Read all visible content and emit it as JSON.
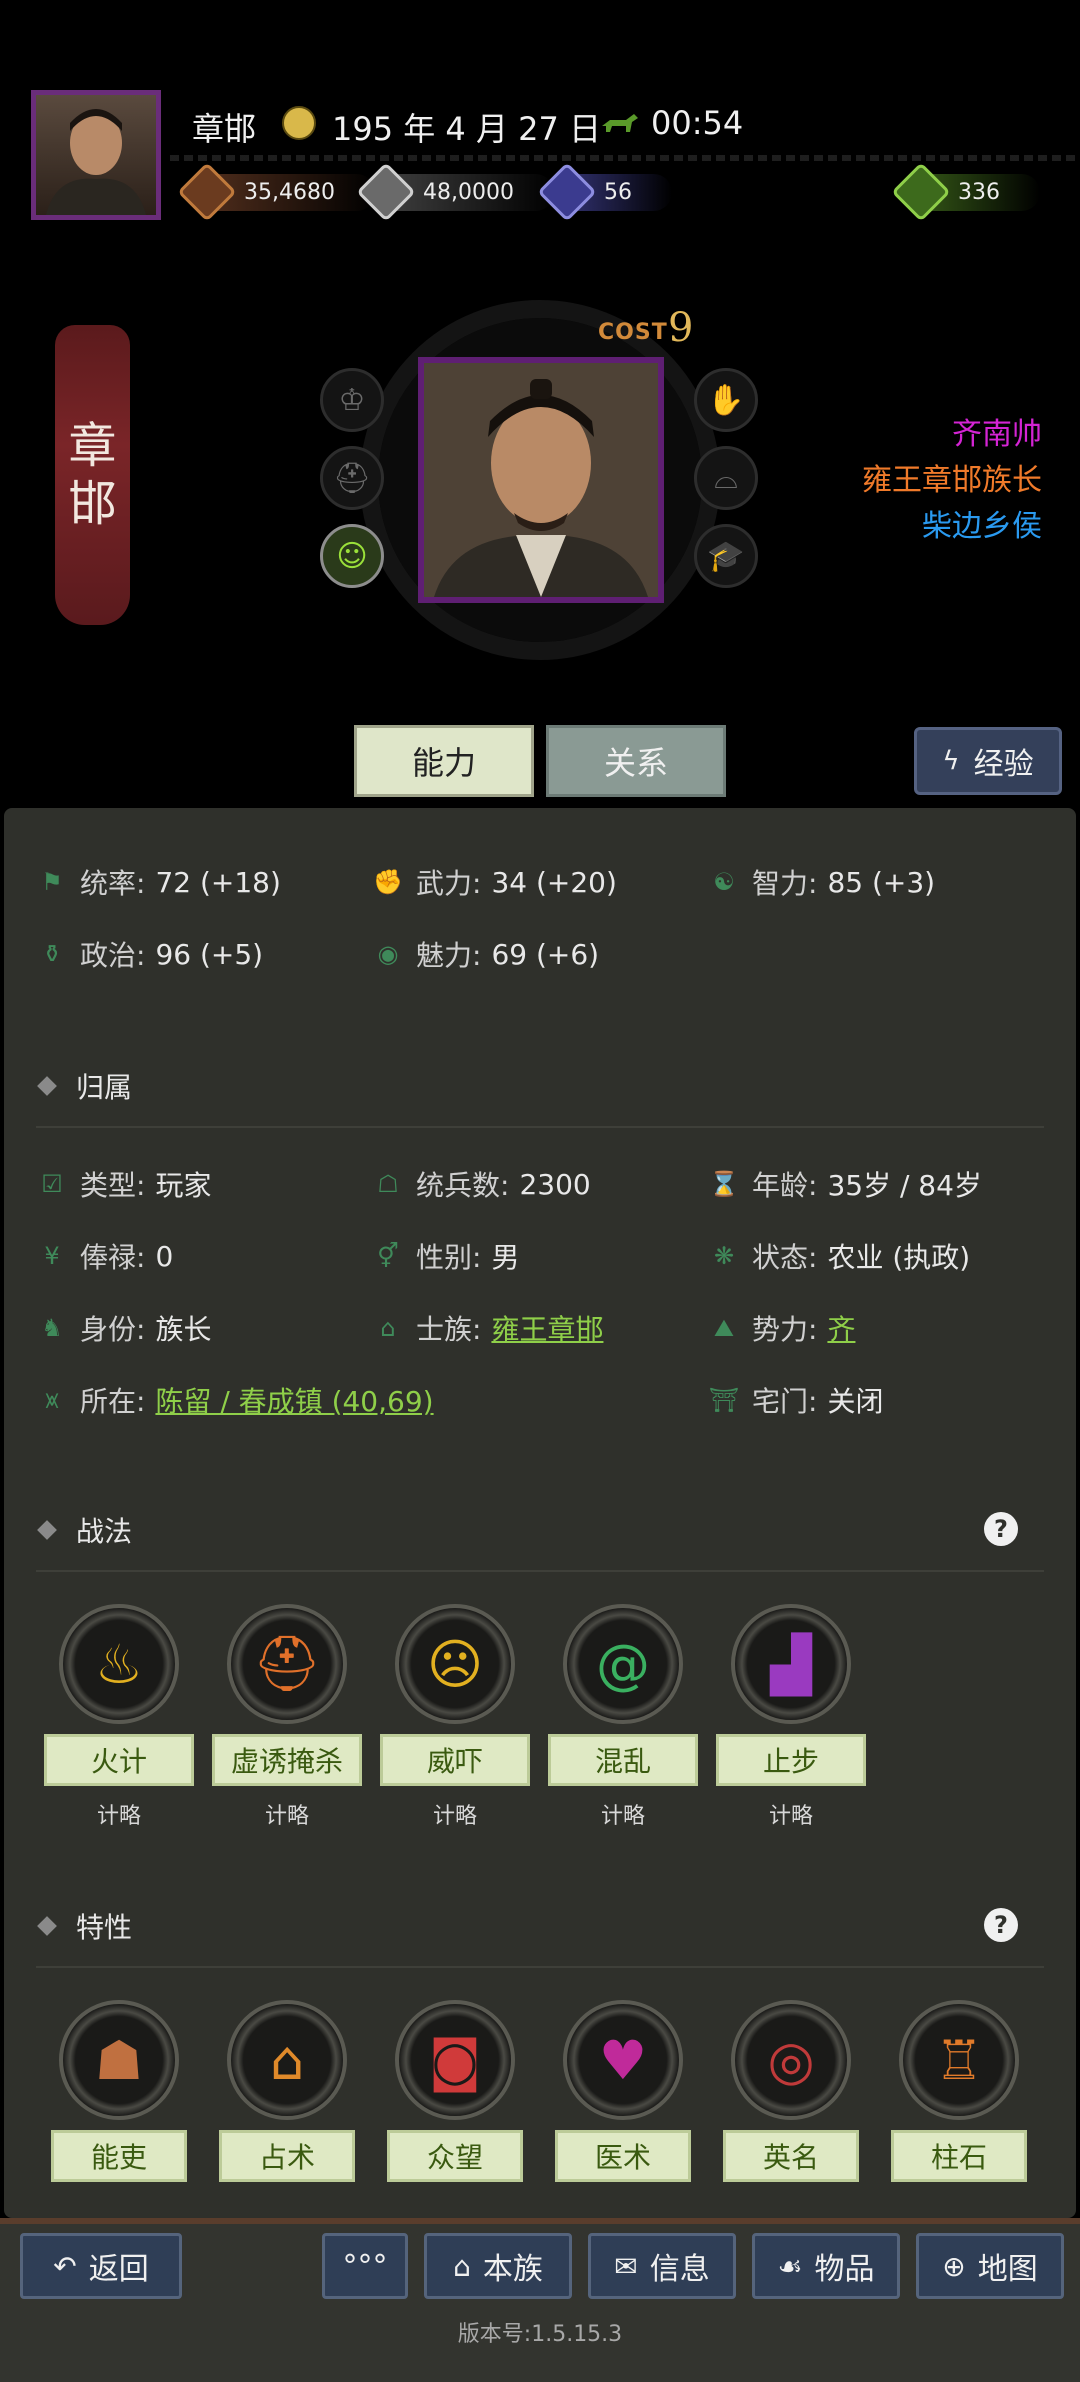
{
  "header": {
    "name": "章邯",
    "date": "195 年 4 月 27 日",
    "time": "00:54",
    "resources": {
      "gold": "35,4680",
      "silver": "48,0000",
      "soldiers": "56",
      "food": "336"
    }
  },
  "character": {
    "banner_chars": [
      "章",
      "邯"
    ],
    "cost_label": "COST",
    "cost_value": "9",
    "titles": [
      {
        "text": "齐南帅",
        "color": "#d424d4"
      },
      {
        "text": "雍王章邯族长",
        "color": "#f07a2a"
      },
      {
        "text": "柴边乡侯",
        "color": "#2a9af0"
      }
    ]
  },
  "tabs": {
    "ability": "能力",
    "relation": "关系",
    "experience": "经验"
  },
  "stats": {
    "command": {
      "label": "统率:",
      "value": "72 (+18)"
    },
    "force": {
      "label": "武力:",
      "value": "34 (+20)"
    },
    "intellect": {
      "label": "智力:",
      "value": "85 (+3)"
    },
    "politics": {
      "label": "政治:",
      "value": "96 (+5)"
    },
    "charm": {
      "label": "魅力:",
      "value": "69 (+6)"
    }
  },
  "affiliation": {
    "heading": "归属",
    "type": {
      "label": "类型:",
      "value": "玩家"
    },
    "troops": {
      "label": "统兵数:",
      "value": "2300"
    },
    "age": {
      "label": "年龄:",
      "value": "35岁 / 84岁"
    },
    "salary": {
      "label": "俸禄:",
      "value": "0"
    },
    "gender": {
      "label": "性别:",
      "value": "男"
    },
    "status": {
      "label": "状态:",
      "value": "农业 (执政)"
    },
    "identity": {
      "label": "身份:",
      "value": "族长"
    },
    "clan": {
      "label": "士族:",
      "value": "雍王章邯"
    },
    "faction": {
      "label": "势力:",
      "value": "齐"
    },
    "location": {
      "label": "所在:",
      "value": "陈留 / 春成镇 (40,69)"
    },
    "residence": {
      "label": "宅门:",
      "value": "关闭"
    }
  },
  "tactics": {
    "heading": "战法",
    "help": "?",
    "items": [
      {
        "name": "火计",
        "kind": "计略",
        "icon": "fire-icon",
        "color": "#e2b020"
      },
      {
        "name": "虚诱掩杀",
        "kind": "计略",
        "icon": "helmet-icon",
        "color": "#e0702a"
      },
      {
        "name": "威吓",
        "kind": "计略",
        "icon": "roar-icon",
        "color": "#e2b020"
      },
      {
        "name": "混乱",
        "kind": "计略",
        "icon": "swirl-icon",
        "color": "#3ab060"
      },
      {
        "name": "止步",
        "kind": "计略",
        "icon": "boot-icon",
        "color": "#9a3ac0"
      }
    ]
  },
  "traits": {
    "heading": "特性",
    "help": "?",
    "items": [
      {
        "name": "能吏",
        "icon": "statue-icon",
        "color": "#c07040"
      },
      {
        "name": "占术",
        "icon": "hut-icon",
        "color": "#e08a2a"
      },
      {
        "name": "众望",
        "icon": "drum-icon",
        "color": "#d03a3a"
      },
      {
        "name": "医术",
        "icon": "heart-icon",
        "color": "#c02a9a"
      },
      {
        "name": "英名",
        "icon": "shield-icon",
        "color": "#c03a3a"
      },
      {
        "name": "柱石",
        "icon": "pillar-icon",
        "color": "#e07a2a"
      }
    ]
  },
  "bottom_nav": {
    "back": "返回",
    "more": "°°°",
    "clan": "本族",
    "info": "信息",
    "items": "物品",
    "map": "地图"
  },
  "version": "版本号:1.5.15.3"
}
